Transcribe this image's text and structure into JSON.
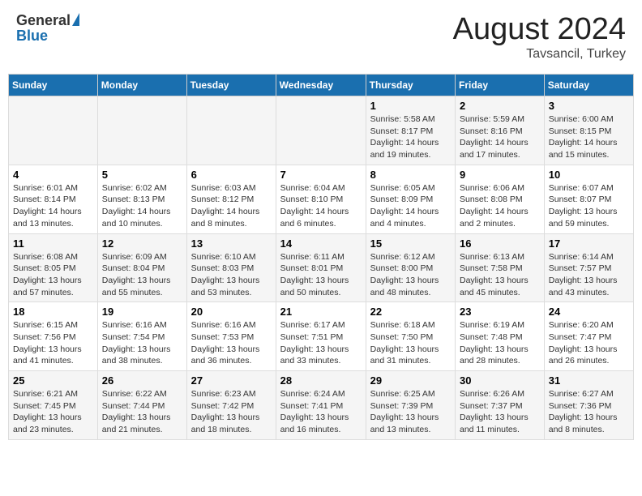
{
  "header": {
    "logo_general": "General",
    "logo_blue": "Blue",
    "month": "August 2024",
    "location": "Tavsancil, Turkey"
  },
  "weekdays": [
    "Sunday",
    "Monday",
    "Tuesday",
    "Wednesday",
    "Thursday",
    "Friday",
    "Saturday"
  ],
  "weeks": [
    [
      {
        "day": "",
        "info": ""
      },
      {
        "day": "",
        "info": ""
      },
      {
        "day": "",
        "info": ""
      },
      {
        "day": "",
        "info": ""
      },
      {
        "day": "1",
        "info": "Sunrise: 5:58 AM\nSunset: 8:17 PM\nDaylight: 14 hours\nand 19 minutes."
      },
      {
        "day": "2",
        "info": "Sunrise: 5:59 AM\nSunset: 8:16 PM\nDaylight: 14 hours\nand 17 minutes."
      },
      {
        "day": "3",
        "info": "Sunrise: 6:00 AM\nSunset: 8:15 PM\nDaylight: 14 hours\nand 15 minutes."
      }
    ],
    [
      {
        "day": "4",
        "info": "Sunrise: 6:01 AM\nSunset: 8:14 PM\nDaylight: 14 hours\nand 13 minutes."
      },
      {
        "day": "5",
        "info": "Sunrise: 6:02 AM\nSunset: 8:13 PM\nDaylight: 14 hours\nand 10 minutes."
      },
      {
        "day": "6",
        "info": "Sunrise: 6:03 AM\nSunset: 8:12 PM\nDaylight: 14 hours\nand 8 minutes."
      },
      {
        "day": "7",
        "info": "Sunrise: 6:04 AM\nSunset: 8:10 PM\nDaylight: 14 hours\nand 6 minutes."
      },
      {
        "day": "8",
        "info": "Sunrise: 6:05 AM\nSunset: 8:09 PM\nDaylight: 14 hours\nand 4 minutes."
      },
      {
        "day": "9",
        "info": "Sunrise: 6:06 AM\nSunset: 8:08 PM\nDaylight: 14 hours\nand 2 minutes."
      },
      {
        "day": "10",
        "info": "Sunrise: 6:07 AM\nSunset: 8:07 PM\nDaylight: 13 hours\nand 59 minutes."
      }
    ],
    [
      {
        "day": "11",
        "info": "Sunrise: 6:08 AM\nSunset: 8:05 PM\nDaylight: 13 hours\nand 57 minutes."
      },
      {
        "day": "12",
        "info": "Sunrise: 6:09 AM\nSunset: 8:04 PM\nDaylight: 13 hours\nand 55 minutes."
      },
      {
        "day": "13",
        "info": "Sunrise: 6:10 AM\nSunset: 8:03 PM\nDaylight: 13 hours\nand 53 minutes."
      },
      {
        "day": "14",
        "info": "Sunrise: 6:11 AM\nSunset: 8:01 PM\nDaylight: 13 hours\nand 50 minutes."
      },
      {
        "day": "15",
        "info": "Sunrise: 6:12 AM\nSunset: 8:00 PM\nDaylight: 13 hours\nand 48 minutes."
      },
      {
        "day": "16",
        "info": "Sunrise: 6:13 AM\nSunset: 7:58 PM\nDaylight: 13 hours\nand 45 minutes."
      },
      {
        "day": "17",
        "info": "Sunrise: 6:14 AM\nSunset: 7:57 PM\nDaylight: 13 hours\nand 43 minutes."
      }
    ],
    [
      {
        "day": "18",
        "info": "Sunrise: 6:15 AM\nSunset: 7:56 PM\nDaylight: 13 hours\nand 41 minutes."
      },
      {
        "day": "19",
        "info": "Sunrise: 6:16 AM\nSunset: 7:54 PM\nDaylight: 13 hours\nand 38 minutes."
      },
      {
        "day": "20",
        "info": "Sunrise: 6:16 AM\nSunset: 7:53 PM\nDaylight: 13 hours\nand 36 minutes."
      },
      {
        "day": "21",
        "info": "Sunrise: 6:17 AM\nSunset: 7:51 PM\nDaylight: 13 hours\nand 33 minutes."
      },
      {
        "day": "22",
        "info": "Sunrise: 6:18 AM\nSunset: 7:50 PM\nDaylight: 13 hours\nand 31 minutes."
      },
      {
        "day": "23",
        "info": "Sunrise: 6:19 AM\nSunset: 7:48 PM\nDaylight: 13 hours\nand 28 minutes."
      },
      {
        "day": "24",
        "info": "Sunrise: 6:20 AM\nSunset: 7:47 PM\nDaylight: 13 hours\nand 26 minutes."
      }
    ],
    [
      {
        "day": "25",
        "info": "Sunrise: 6:21 AM\nSunset: 7:45 PM\nDaylight: 13 hours\nand 23 minutes."
      },
      {
        "day": "26",
        "info": "Sunrise: 6:22 AM\nSunset: 7:44 PM\nDaylight: 13 hours\nand 21 minutes."
      },
      {
        "day": "27",
        "info": "Sunrise: 6:23 AM\nSunset: 7:42 PM\nDaylight: 13 hours\nand 18 minutes."
      },
      {
        "day": "28",
        "info": "Sunrise: 6:24 AM\nSunset: 7:41 PM\nDaylight: 13 hours\nand 16 minutes."
      },
      {
        "day": "29",
        "info": "Sunrise: 6:25 AM\nSunset: 7:39 PM\nDaylight: 13 hours\nand 13 minutes."
      },
      {
        "day": "30",
        "info": "Sunrise: 6:26 AM\nSunset: 7:37 PM\nDaylight: 13 hours\nand 11 minutes."
      },
      {
        "day": "31",
        "info": "Sunrise: 6:27 AM\nSunset: 7:36 PM\nDaylight: 13 hours\nand 8 minutes."
      }
    ]
  ]
}
